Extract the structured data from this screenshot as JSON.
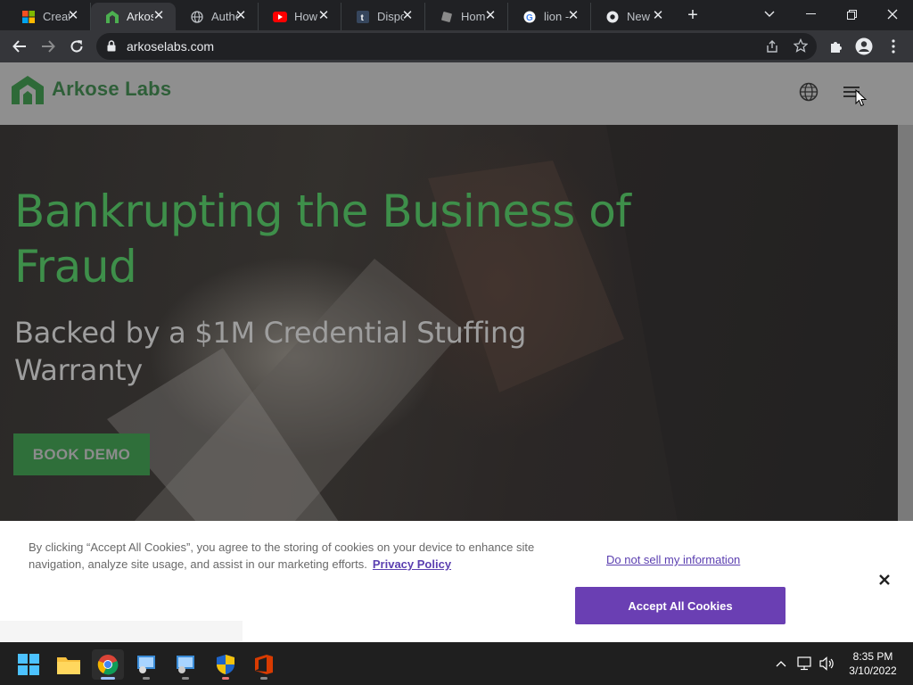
{
  "browser": {
    "tabs": [
      {
        "title": "Creat",
        "icon": "microsoft-icon"
      },
      {
        "title": "Arkos",
        "icon": "arkose-icon",
        "active": true
      },
      {
        "title": "Authe",
        "icon": "globe-icon"
      },
      {
        "title": "How",
        "icon": "youtube-icon"
      },
      {
        "title": "Dispo",
        "icon": "tumblr-icon"
      },
      {
        "title": "Hom",
        "icon": "page-icon"
      },
      {
        "title": "lion -",
        "icon": "google-icon"
      },
      {
        "title": "New",
        "icon": "chrome-icon"
      }
    ],
    "url": "arkoselabs.com"
  },
  "site": {
    "logo_text": "Arkose Labs",
    "hero_title": "Bankrupting the Business of Fraud",
    "hero_subtitle": "Backed by a $1M Credential Stuffing Warranty",
    "cta_label": "BOOK DEMO"
  },
  "cookie_banner": {
    "text": "By clicking “Accept All Cookies”, you agree to the storing of cookies on your device to enhance site navigation, analyze site usage, and assist in our marketing efforts.",
    "privacy_link": "Privacy Policy",
    "do_not_sell": "Do not sell my information",
    "accept_label": "Accept All Cookies"
  },
  "taskbar": {
    "time": "8:35 PM",
    "date": "3/10/2022"
  },
  "colors": {
    "brand_green": "#3e8f4a",
    "cookie_purple": "#6a3fb3"
  }
}
